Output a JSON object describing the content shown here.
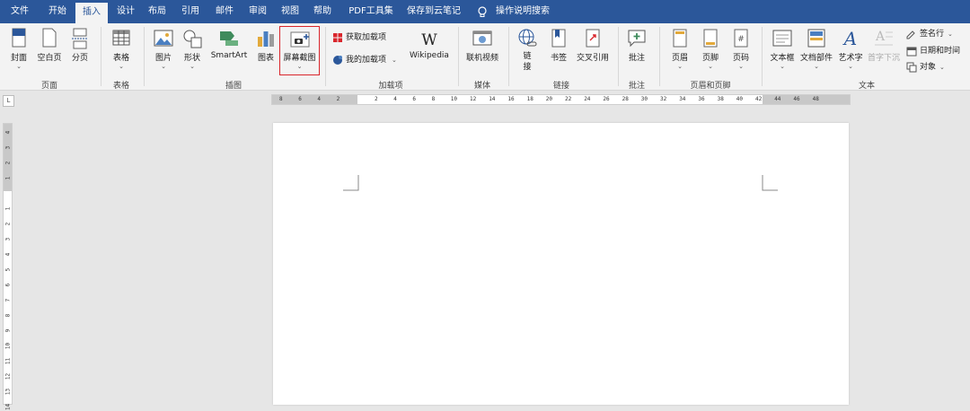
{
  "tabs": [
    {
      "label": "文件",
      "active": false
    },
    {
      "label": "开始",
      "active": false
    },
    {
      "label": "插入",
      "active": true
    },
    {
      "label": "设计",
      "active": false
    },
    {
      "label": "布局",
      "active": false
    },
    {
      "label": "引用",
      "active": false
    },
    {
      "label": "邮件",
      "active": false
    },
    {
      "label": "审阅",
      "active": false
    },
    {
      "label": "视图",
      "active": false
    },
    {
      "label": "帮助",
      "active": false
    },
    {
      "label": "PDF工具集",
      "active": false
    },
    {
      "label": "保存到云笔记",
      "active": false
    }
  ],
  "search_label": "操作说明搜索",
  "groups": {
    "pages": {
      "label": "页面",
      "cover": "封面",
      "blank": "空白页",
      "break": "分页"
    },
    "tables": {
      "label": "表格",
      "table": "表格"
    },
    "illustrations": {
      "label": "插图",
      "picture": "图片",
      "shapes": "形状",
      "smartart": "SmartArt",
      "chart": "图表",
      "screenshot": "屏幕截图"
    },
    "addins": {
      "label": "加载项",
      "get": "获取加载项",
      "my": "我的加载项",
      "wikipedia": "Wikipedia"
    },
    "media": {
      "label": "媒体",
      "video": "联机视频"
    },
    "links": {
      "label": "链接",
      "link": "链\n接",
      "bookmark": "书签",
      "crossref": "交叉引用"
    },
    "comments": {
      "label": "批注",
      "comment": "批注"
    },
    "header_footer": {
      "label": "页眉和页脚",
      "header": "页眉",
      "footer": "页脚",
      "page_number": "页码"
    },
    "text": {
      "label": "文本",
      "textbox": "文本框",
      "quickparts": "文档部件",
      "wordart": "艺术字",
      "dropcap": "首字下沉",
      "signature": "签名行",
      "datetime": "日期和时间",
      "object": "对象"
    }
  },
  "ruler": {
    "h_ticks": [
      "8",
      "6",
      "4",
      "2",
      "",
      "2",
      "4",
      "6",
      "8",
      "10",
      "12",
      "14",
      "16",
      "18",
      "20",
      "22",
      "24",
      "26",
      "28",
      "30",
      "32",
      "34",
      "36",
      "38",
      "40",
      "42",
      "44",
      "46",
      "48"
    ],
    "v_ticks": [
      "4",
      "3",
      "2",
      "1",
      "",
      "1",
      "2",
      "3",
      "4",
      "5",
      "6",
      "7",
      "8",
      "9",
      "10",
      "11",
      "12",
      "13",
      "14"
    ]
  },
  "colors": {
    "accent": "#2b579a",
    "highlight": "#d9262c"
  }
}
